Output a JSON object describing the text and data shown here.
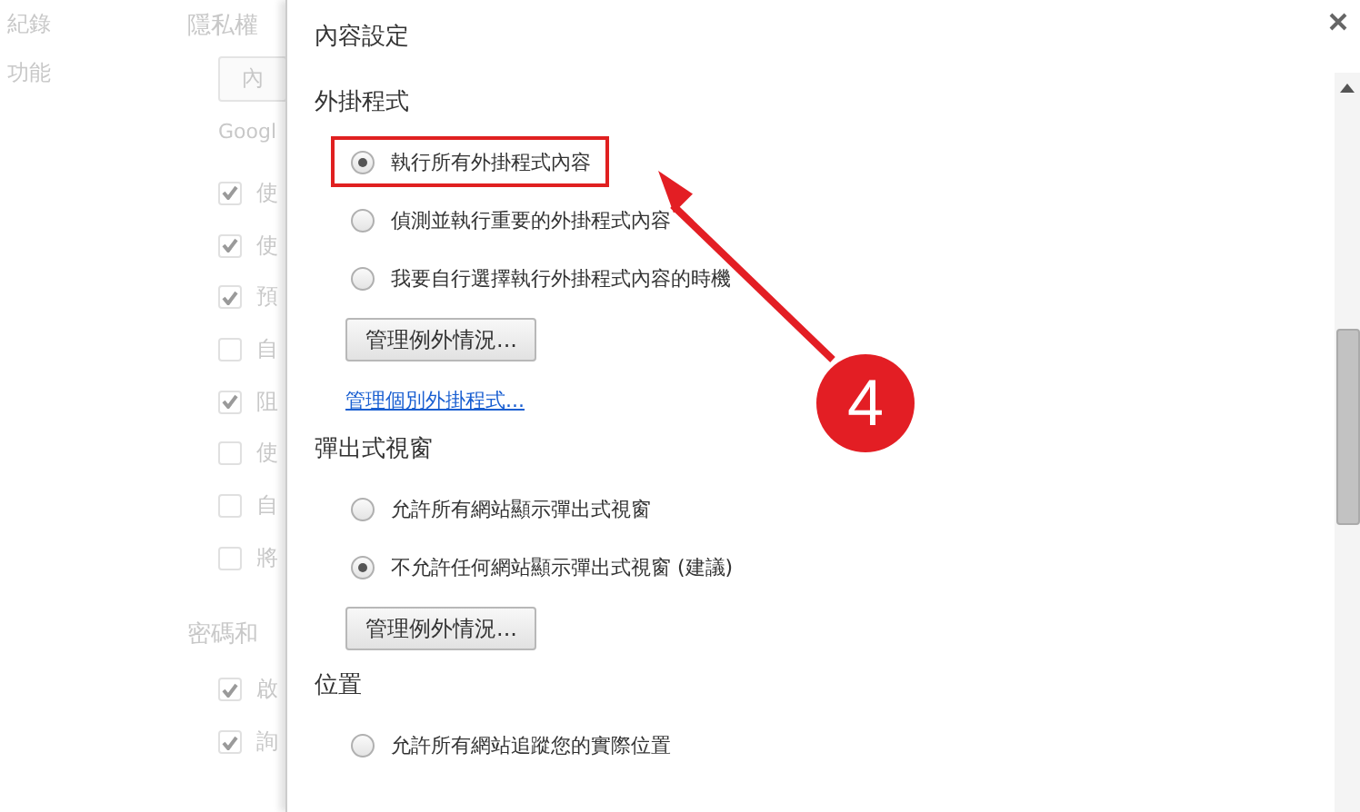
{
  "background": {
    "sidebar": [
      "紀錄",
      "功能"
    ],
    "section_title": "隱私權",
    "button": "內",
    "note": "Googl",
    "checks": [
      {
        "label": "使",
        "checked": true
      },
      {
        "label": "使",
        "checked": true
      },
      {
        "label": "預",
        "checked": true
      },
      {
        "label": "自",
        "checked": false
      },
      {
        "label": "阻",
        "checked": true
      },
      {
        "label": "使",
        "checked": false
      },
      {
        "label": "自",
        "checked": false
      },
      {
        "label": "將",
        "checked": false
      }
    ],
    "section2_title": "密碼和",
    "checks2": [
      {
        "label": "啟",
        "checked": true
      },
      {
        "label": "詢",
        "checked": true
      }
    ]
  },
  "dialog": {
    "title": "內容設定",
    "sections": [
      {
        "title": "外掛程式",
        "options": [
          {
            "label": "執行所有外掛程式內容",
            "selected": true,
            "highlighted": true
          },
          {
            "label": "偵測並執行重要的外掛程式內容",
            "selected": false,
            "highlighted": false
          },
          {
            "label": "我要自行選擇執行外掛程式內容的時機",
            "selected": false,
            "highlighted": false
          }
        ],
        "button": "管理例外情況...",
        "link": "管理個別外掛程式..."
      },
      {
        "title": "彈出式視窗",
        "options": [
          {
            "label": "允許所有網站顯示彈出式視窗",
            "selected": false,
            "highlighted": false
          },
          {
            "label": "不允許任何網站顯示彈出式視窗 (建議)",
            "selected": true,
            "highlighted": false
          }
        ],
        "button": "管理例外情況..."
      },
      {
        "title": "位置",
        "options": [
          {
            "label": "允許所有網站追蹤您的實際位置",
            "selected": false,
            "highlighted": false
          }
        ]
      }
    ]
  },
  "annotation": {
    "badge": "4"
  }
}
